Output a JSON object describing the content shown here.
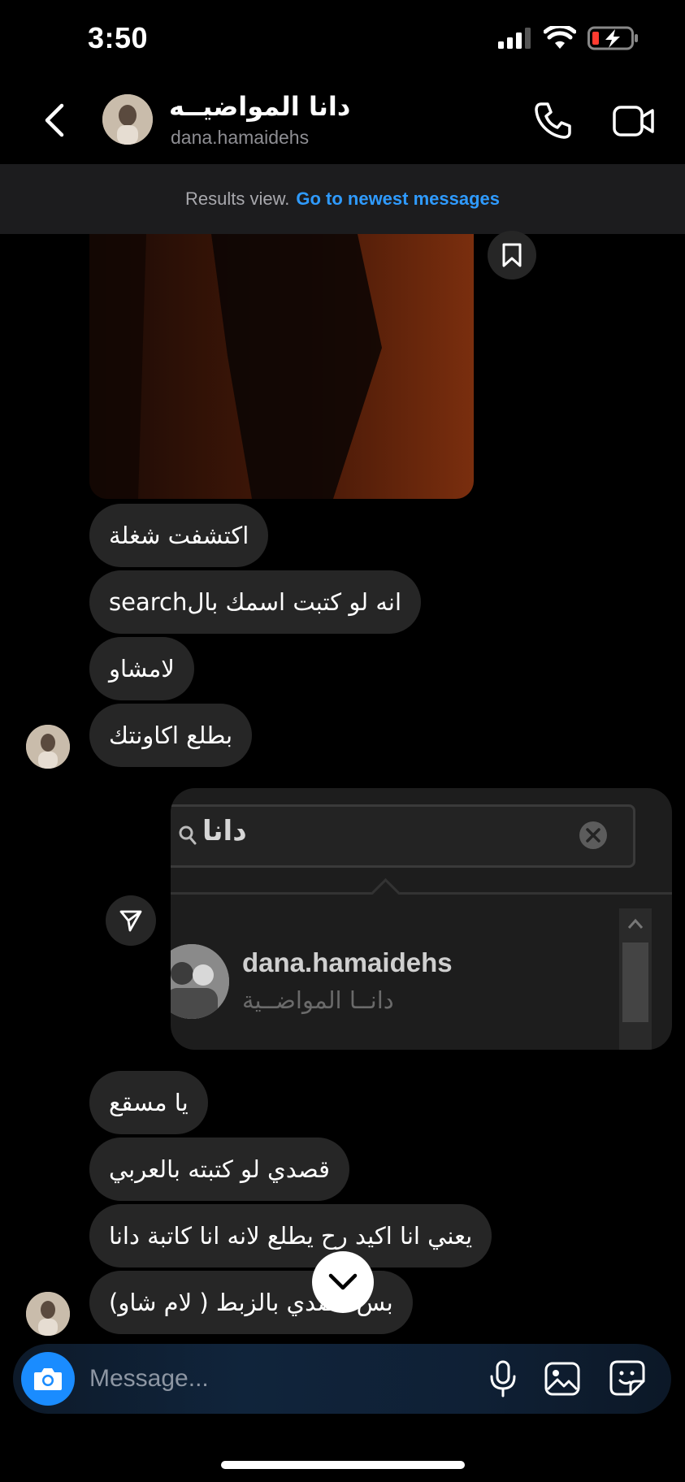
{
  "status_bar": {
    "time": "3:50"
  },
  "header": {
    "contact_name": "دانا المواضيــه",
    "contact_handle": "dana.hamaidehs"
  },
  "banner": {
    "text": "Results view.",
    "link": "Go to newest messages"
  },
  "messages": [
    {
      "text": "اكتشفت شغلة"
    },
    {
      "text": "انه لو كتبت اسمك بالsearch"
    },
    {
      "text": "لامشاو"
    },
    {
      "text": "بطلع اكاونتك"
    },
    {
      "text": "يا مسقع"
    },
    {
      "text": "قصدي لو كتبته بالعربي"
    },
    {
      "text": "يعني انا اكيد رح يطلع لانه انا كاتبة دانا"
    },
    {
      "text": "بس قصدي بالزبط ( لام شاو)"
    }
  ],
  "shared_screenshot": {
    "search_query": "دانا",
    "result_username": "dana.hamaidehs",
    "result_fullname": "دانــا المواضــية"
  },
  "composer": {
    "placeholder": "Message..."
  },
  "colors": {
    "accent_blue": "#2f9bff",
    "bubble": "#262626",
    "camera": "#1a8cff"
  }
}
